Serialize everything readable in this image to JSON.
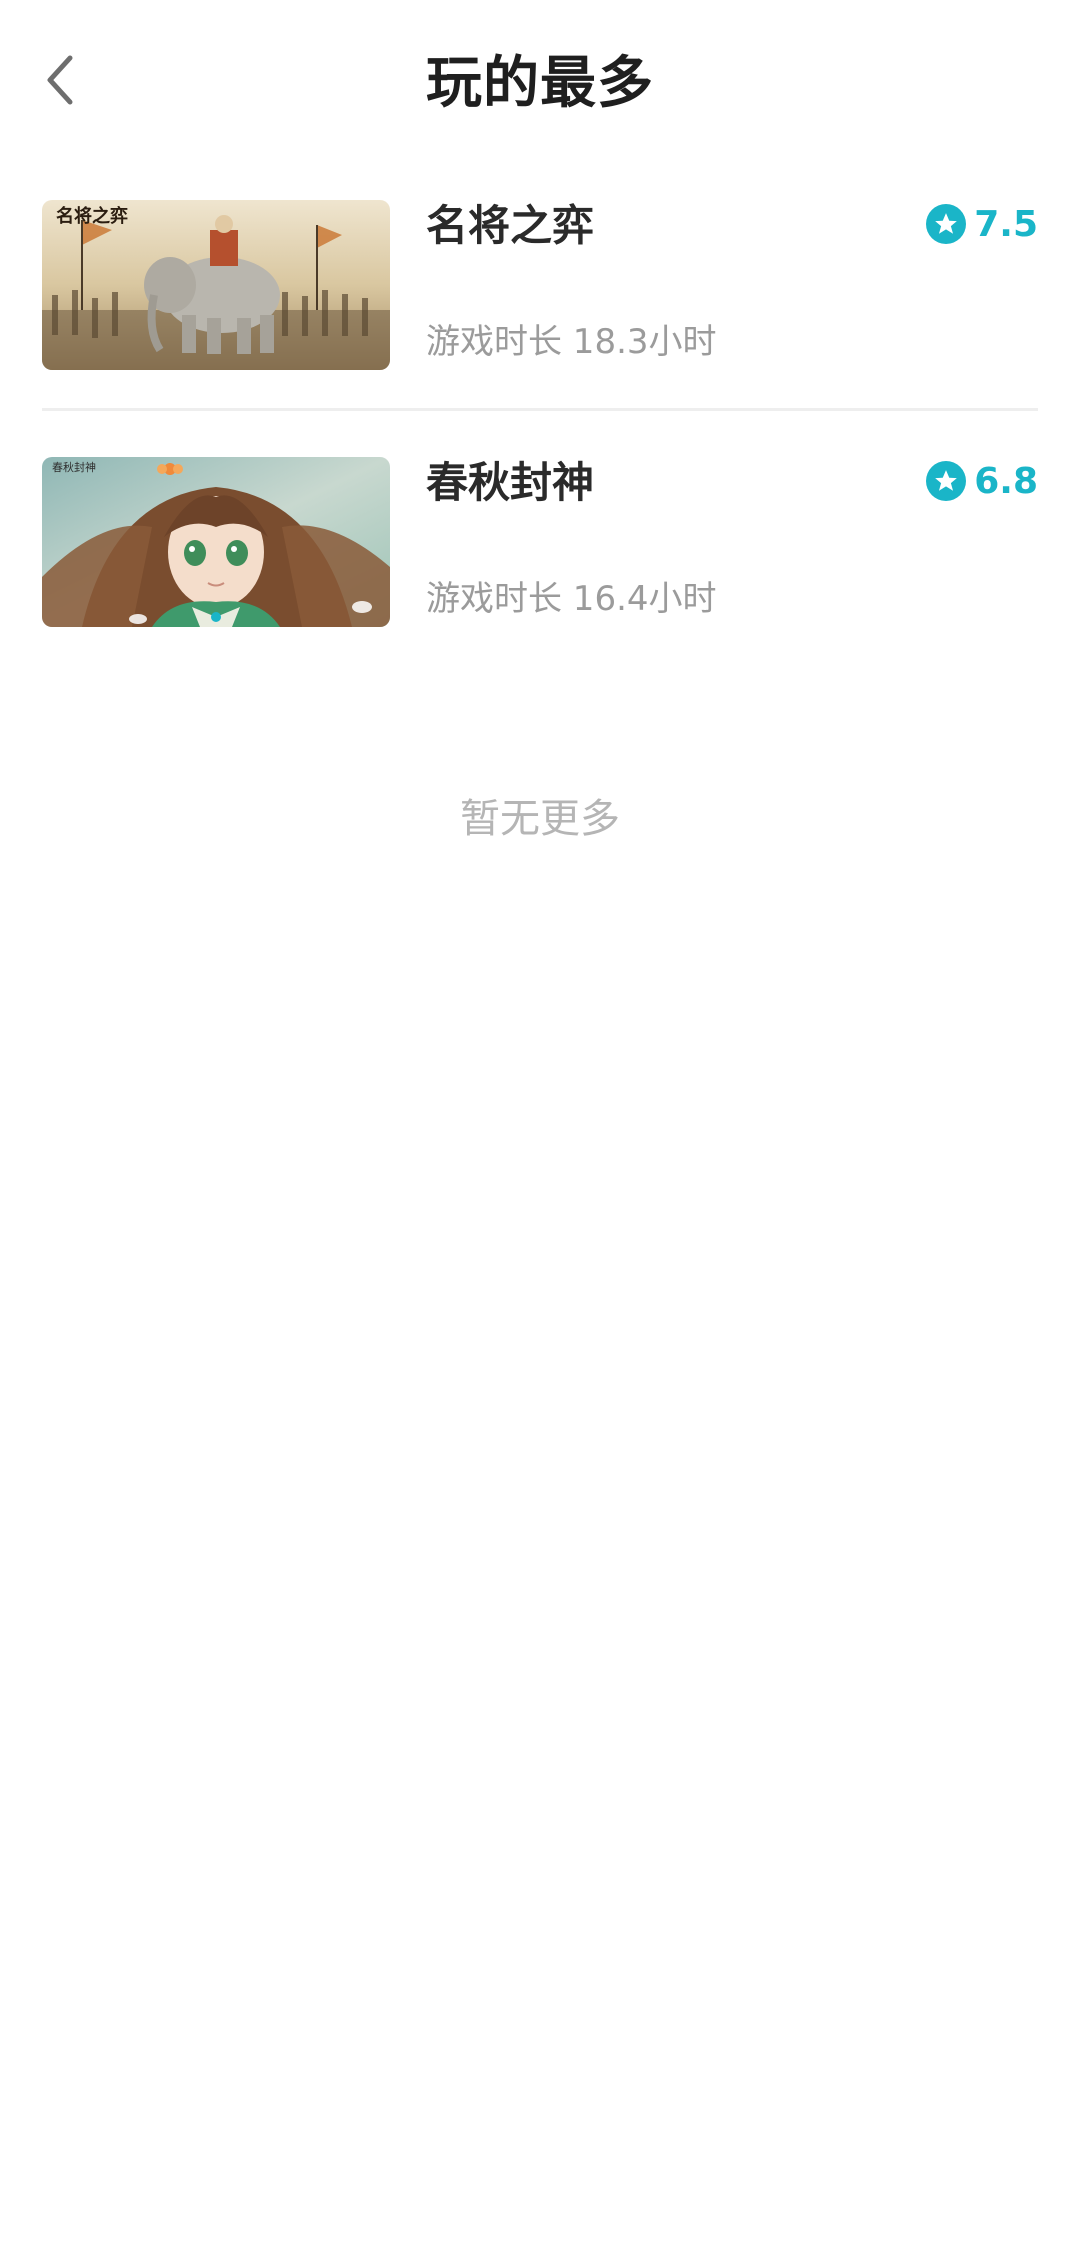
{
  "header": {
    "title": "玩的最多",
    "back_icon": "chevron-left-icon"
  },
  "colors": {
    "accent": "#1ab5c8",
    "title": "#1f1f1f",
    "secondary": "#9b9b9b",
    "footer": "#b5b5b5"
  },
  "games": [
    {
      "name": "名将之弈",
      "rating": "7.5",
      "playtime": "游戏时长 18.3小时",
      "thumb_text": "名将之弈"
    },
    {
      "name": "春秋封神",
      "rating": "6.8",
      "playtime": "游戏时长 16.4小时",
      "thumb_text": "春秋封神"
    }
  ],
  "footer": {
    "no_more": "暂无更多"
  }
}
